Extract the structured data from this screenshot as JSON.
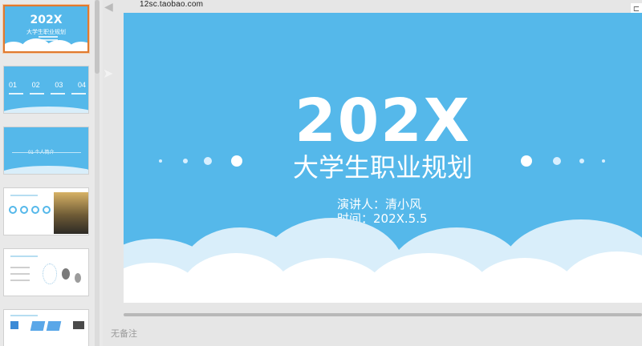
{
  "url_label": "12sc.taobao.com",
  "slide": {
    "title": "202X",
    "subtitle": "大学生职业规划",
    "presenter": "演讲人：清小风",
    "time": "时间：202X.5.5"
  },
  "thumb1": {
    "title": "202X",
    "subtitle": "大学生职业规划"
  },
  "thumb2": {
    "nums": [
      "01",
      "02",
      "03",
      "04"
    ]
  },
  "thumb3": {
    "label": "01 个人简介"
  },
  "notes_placeholder": "无备注",
  "colors": {
    "slide_bg": "#55b8ea",
    "selected_border": "#e07a2f"
  },
  "icons": {
    "speaker": "speaker-icon",
    "plane": "paper-plane-icon",
    "panel_toggle": "panel-toggle-icon"
  }
}
